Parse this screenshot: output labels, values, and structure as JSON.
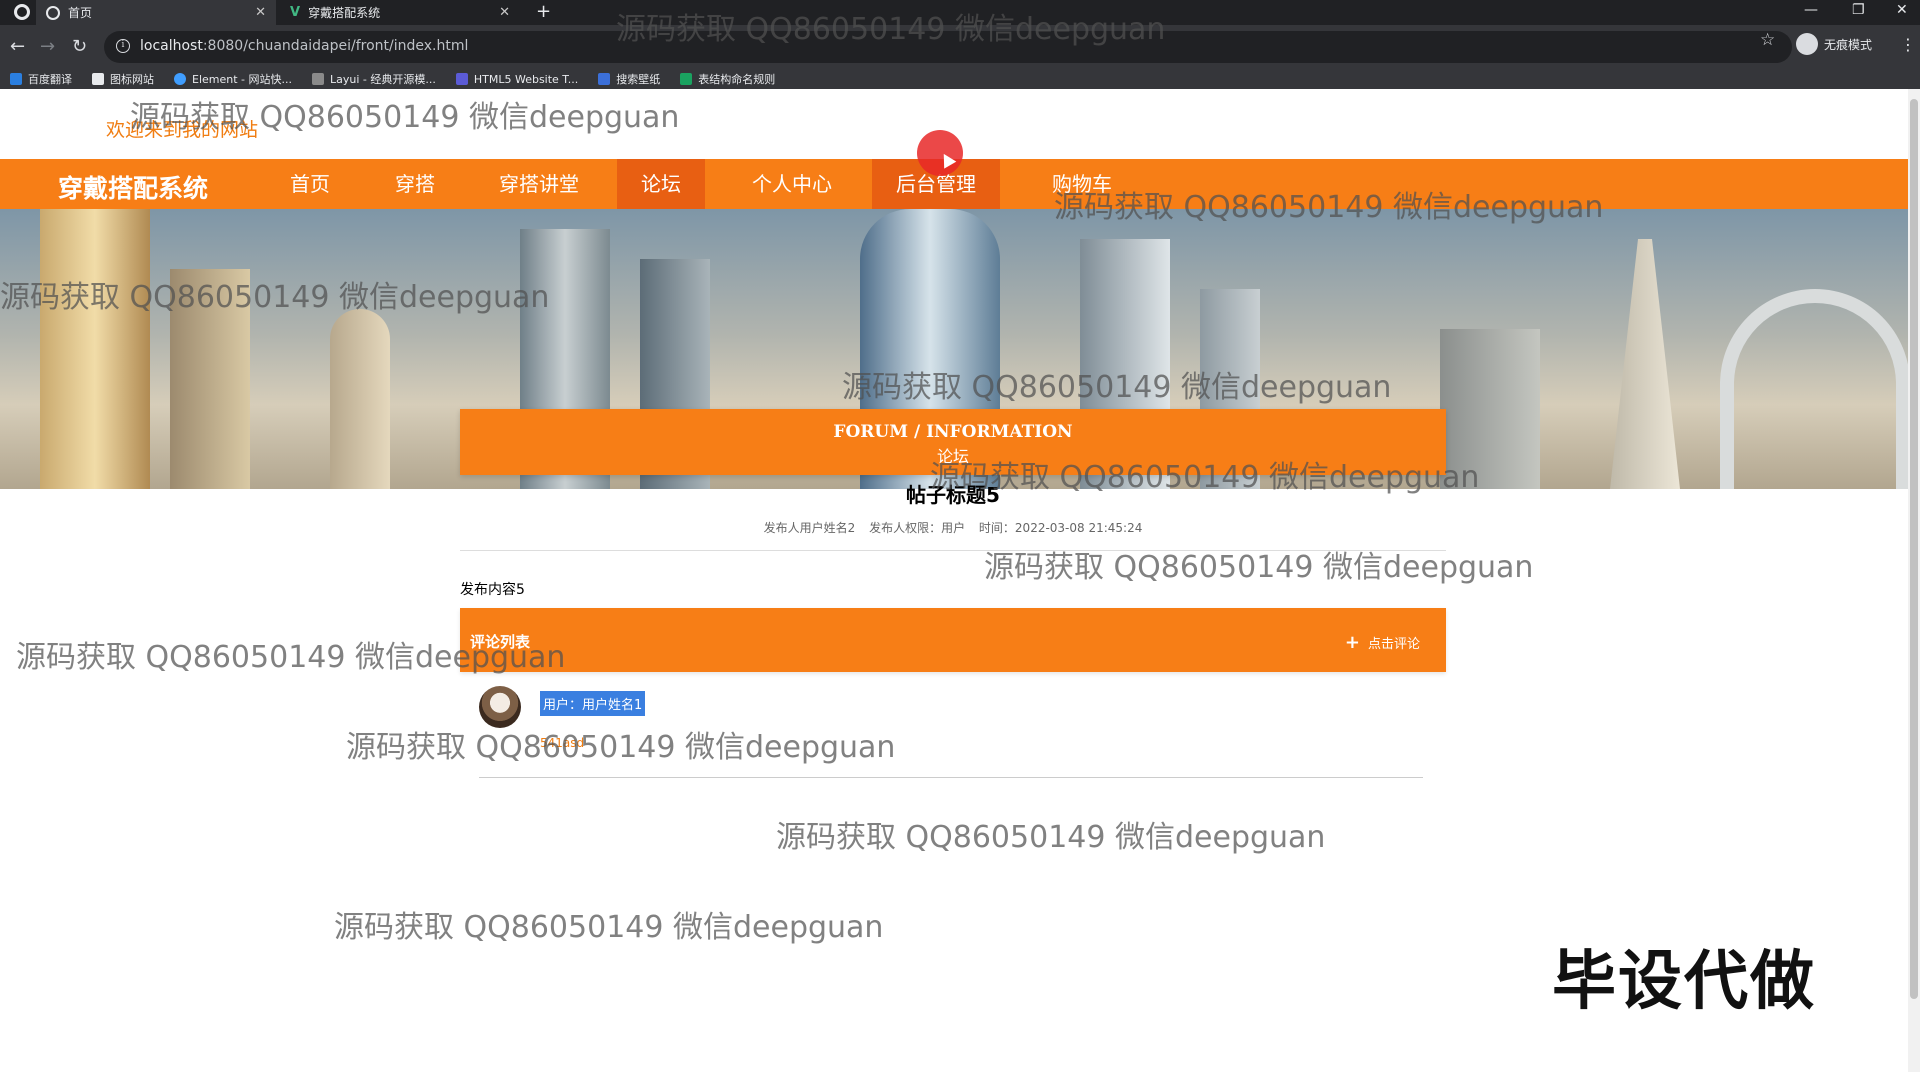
{
  "browser": {
    "tabs": [
      {
        "title": "首页",
        "active": true
      },
      {
        "title": "穿戴搭配系统",
        "active": false
      }
    ],
    "url_host": "localhost",
    "url_path": ":8080/chuandaidapei/front/index.html",
    "profile_label": "无痕模式",
    "bookmarks": [
      "百度翻译",
      "图标网站",
      "Element - 网站快...",
      "Layui - 经典开源模...",
      "HTML5 Website T...",
      "搜索壁纸",
      "表结构命名规则"
    ]
  },
  "site": {
    "welcome": "欢迎来到我的网站",
    "brand": "穿戴搭配系统",
    "nav": [
      "首页",
      "穿搭",
      "穿搭讲堂",
      "论坛",
      "个人中心",
      "后台管理",
      "购物车"
    ],
    "active_nav": "论坛"
  },
  "forum": {
    "header_en": "FORUM / INFORMATION",
    "header_cn": "论坛",
    "post_title": "帖子标题5",
    "meta_author": "发布人用户姓名2",
    "meta_role": "发布人权限：用户",
    "meta_time": "时间：2022-03-08 21:45:24",
    "content": "发布内容5",
    "comment_list_label": "评论列表",
    "comment_button": "点击评论",
    "comments": [
      {
        "user": "用户：用户姓名1",
        "text": "541asd"
      }
    ]
  },
  "watermarks": {
    "text": "源码获取 QQ86050149 微信deepguan",
    "stamp": "毕设代做"
  },
  "colors": {
    "accent": "#f77e16",
    "accent_dark": "#e85f12",
    "chrome_dark": "#202124"
  }
}
